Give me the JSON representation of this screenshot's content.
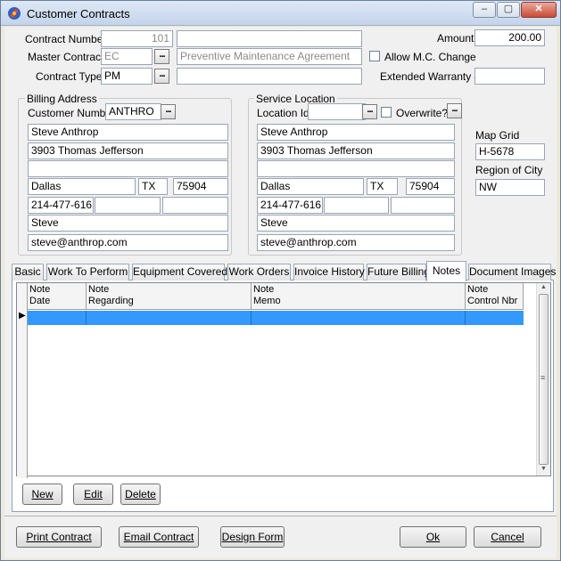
{
  "window": {
    "title": "Customer Contracts",
    "minimize": "‒",
    "maximize": "▢",
    "close": "✕"
  },
  "header": {
    "contract_number_label": "Contract Number",
    "contract_number": "101",
    "contract_desc": "",
    "master_contract_label": "Master Contract",
    "master_contract": "EC",
    "master_contract_desc": "Preventive Maintenance Agreement",
    "contract_type_label": "Contract Type",
    "contract_type": "PM",
    "contract_type_desc": "",
    "amount_label": "Amount",
    "amount": "200.00",
    "allow_mc_change_label": "Allow M.C. Change",
    "extended_warranty_label": "Extended Warranty #",
    "extended_warranty": "",
    "ellipsis": "..."
  },
  "billing": {
    "title": "Billing Address",
    "customer_number_label": "Customer Number",
    "customer_number": "ANTHRO",
    "name": "Steve Anthrop",
    "address1": "3903 Thomas Jefferson",
    "address2": "",
    "city": "Dallas",
    "state": "TX",
    "zip": "75904",
    "phone1": "214-477-6161",
    "phone2": "",
    "phone3": "",
    "contact": "Steve",
    "email": "steve@anthrop.com"
  },
  "service": {
    "title": "Service Location",
    "location_id_label": "Location Id",
    "location_id": "",
    "overwrite_label": "Overwrite?",
    "name": "Steve Anthrop",
    "address1": "3903 Thomas Jefferson",
    "address2": "",
    "city": "Dallas",
    "state": "TX",
    "zip": "75904",
    "phone1": "214-477-6161",
    "phone2": "",
    "phone3": "",
    "contact": "Steve",
    "email": "steve@anthrop.com"
  },
  "map": {
    "map_grid_label": "Map Grid",
    "map_grid": "H-5678",
    "region_label": "Region of City",
    "region": "NW"
  },
  "tabs": [
    {
      "label": "Basic"
    },
    {
      "label": "Work To Perform"
    },
    {
      "label": "Equipment Covered"
    },
    {
      "label": "Work Orders"
    },
    {
      "label": "Invoice History"
    },
    {
      "label": "Future Billing"
    },
    {
      "label": "Notes"
    },
    {
      "label": "Document Images"
    }
  ],
  "notes_grid": {
    "columns": [
      {
        "line1": "Note",
        "line2": "Date"
      },
      {
        "line1": "Note",
        "line2": "Regarding"
      },
      {
        "line1": "Note",
        "line2": "Memo"
      },
      {
        "line1": "Note",
        "line2": "Control Nbr"
      }
    ],
    "row_indicator": "▶",
    "scroll_up": "▲",
    "scroll_down": "▼",
    "scroll_grip": "≡"
  },
  "grid_buttons": {
    "new": "New",
    "edit": "Edit",
    "delete": "Delete"
  },
  "footer_buttons": {
    "print_contract": "Print Contract",
    "email_contract": "Email Contract",
    "design_form": "Design Form",
    "ok": "Ok",
    "cancel": "Cancel"
  }
}
